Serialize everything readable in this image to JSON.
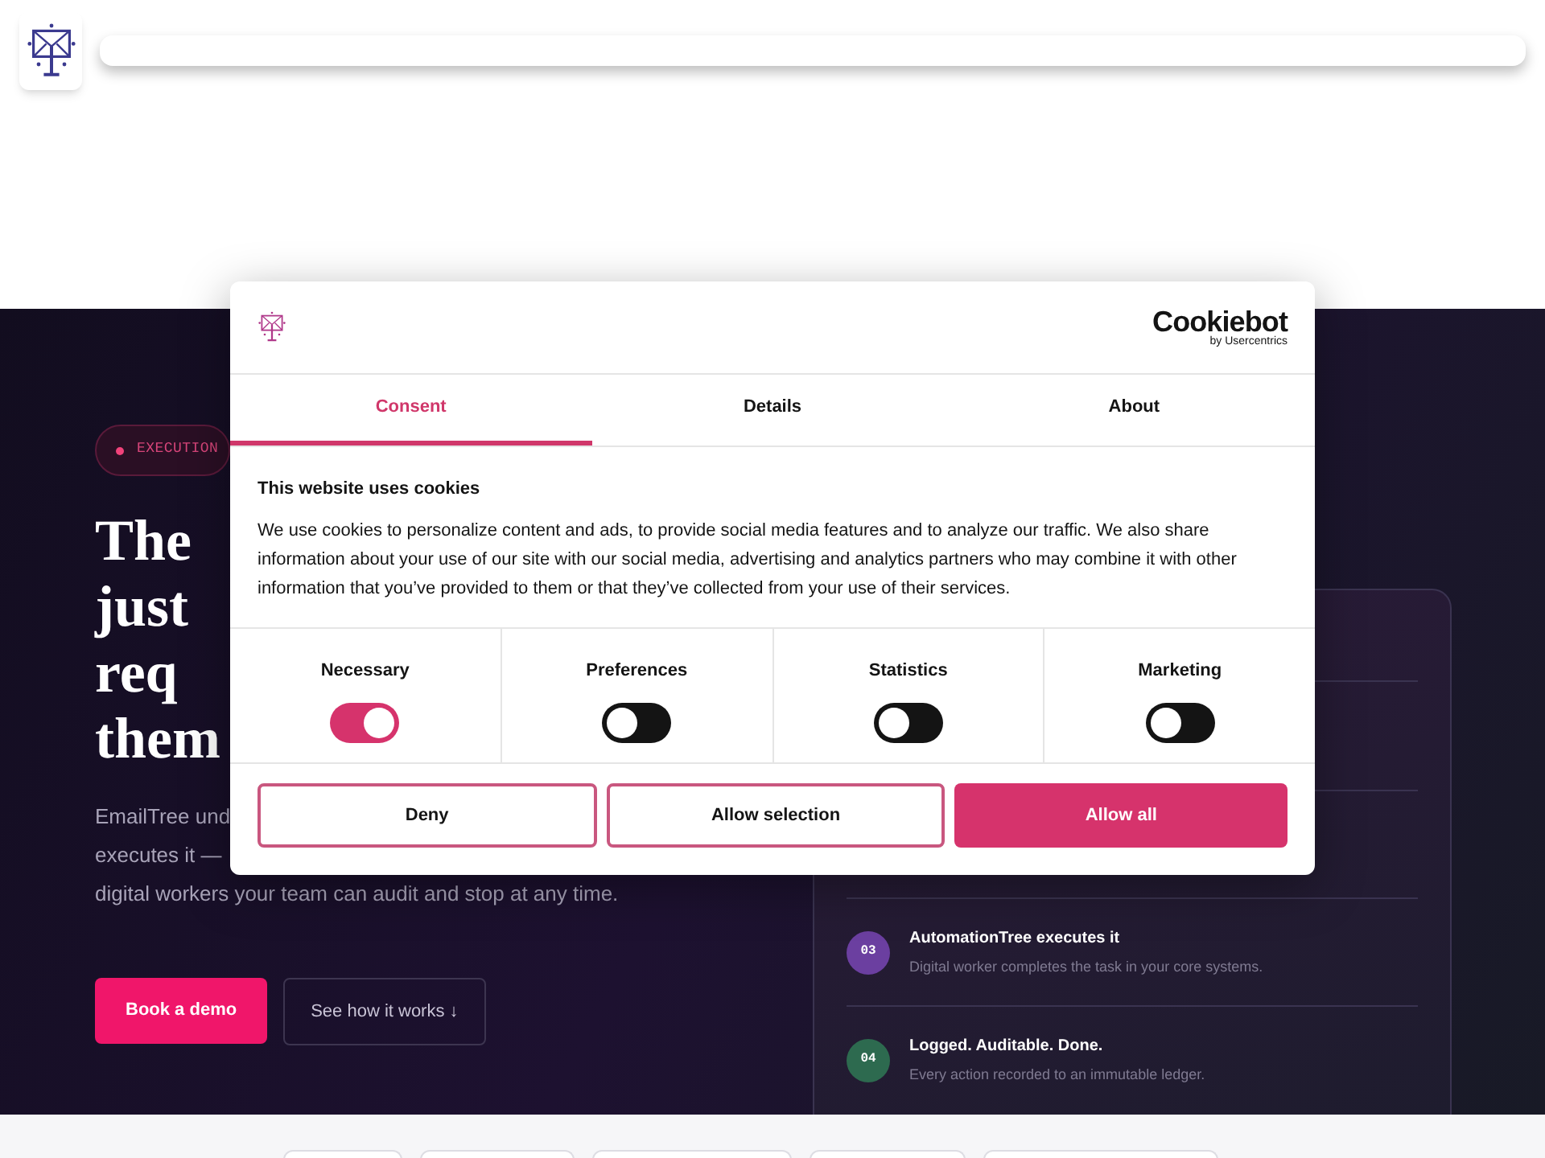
{
  "hero": {
    "badge": "EXECUTION",
    "heading_lines": [
      "The",
      "just",
      "req",
      "them"
    ],
    "paragraph_lines": [
      "EmailTree und",
      "executes it —",
      "digital workers your team can audit and stop at any time."
    ],
    "buttons": [
      {
        "label": "Book a demo",
        "kind": "primary"
      },
      {
        "label": "See how it works ↓",
        "kind": "secondary"
      }
    ]
  },
  "steps": [
    {
      "number": "03",
      "title": "AutomationTree executes it",
      "text": "Digital worker completes the task in your core systems.",
      "color": "#6b3fa0"
    },
    {
      "number": "04",
      "title": "Logged. Auditable. Done.",
      "text": "Every action recorded to an immutable ledger.",
      "color": "#2d6a4f"
    }
  ],
  "cookie_dialog": {
    "brand": "Cookiebot",
    "brand_sub": "by Usercentrics",
    "tabs": [
      {
        "label": "Consent",
        "selected": true
      },
      {
        "label": "Details",
        "selected": false
      },
      {
        "label": "About",
        "selected": false
      }
    ],
    "title": "This website uses cookies",
    "text": "We use cookies to personalize content and ads, to provide social media features and to analyze our traffic. We also share information about your use of our site with our social media, advertising and analytics partners who may combine it with other information that you’ve provided to them or that they’ve collected from your use of their services.",
    "categories": [
      {
        "label": "Necessary",
        "on": true
      },
      {
        "label": "Preferences",
        "on": false
      },
      {
        "label": "Statistics",
        "on": false
      },
      {
        "label": "Marketing",
        "on": false
      }
    ],
    "buttons": [
      {
        "label": "Deny",
        "kind": "outline"
      },
      {
        "label": "Allow selection",
        "kind": "outline"
      },
      {
        "label": "Allow all",
        "kind": "filled"
      }
    ]
  }
}
